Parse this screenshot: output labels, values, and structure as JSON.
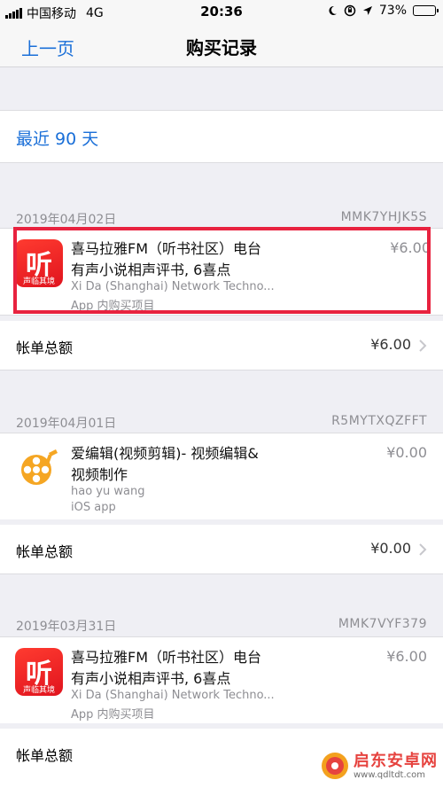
{
  "statusbar": {
    "carrier": "中国移动",
    "network": "4G",
    "time": "20:36",
    "battery": "73%",
    "battery_level": 0.73
  },
  "nav": {
    "back_label": "上一页",
    "title": "购买记录"
  },
  "filter": {
    "label": "最近 90 天"
  },
  "sections": [
    {
      "date": "2019年04月02日",
      "code": "MMK7YHJK5S",
      "item": {
        "name1": "喜马拉雅FM（听书社区）电台",
        "name2": "有声小说相声评书, 6喜点",
        "developer": "Xi Da (Shanghai) Network Techno...",
        "type": "App 内购买项目",
        "price": "¥6.00",
        "icon_text": "听",
        "icon_sub": "声临其境"
      },
      "total_label": "帐单总额",
      "total": "¥6.00"
    },
    {
      "date": "2019年04月01日",
      "code": "R5MYTXQZFFT",
      "item": {
        "name1": "爱编辑(视频剪辑)- 视频编辑&",
        "name2": "视频制作",
        "developer": "hao yu wang",
        "type": "iOS app",
        "price": "¥0.00"
      },
      "total_label": "帐单总额",
      "total": "¥0.00"
    },
    {
      "date": "2019年03月31日",
      "code": "MMK7VYF379",
      "item": {
        "name1": "喜马拉雅FM（听书社区）电台",
        "name2": "有声小说相声评书, 6喜点",
        "developer": "Xi Da (Shanghai) Network Techno...",
        "type": "App 内购买项目",
        "price": "¥6.00",
        "icon_text": "听",
        "icon_sub": "声临其境"
      },
      "total_label": "帐单总额"
    }
  ],
  "watermark": {
    "text": "启东安卓网",
    "url": "www.qdltdt.com"
  },
  "colors": {
    "accent": "#1a6fd8",
    "highlight": "#e8223f",
    "battery": "#4cd964"
  }
}
